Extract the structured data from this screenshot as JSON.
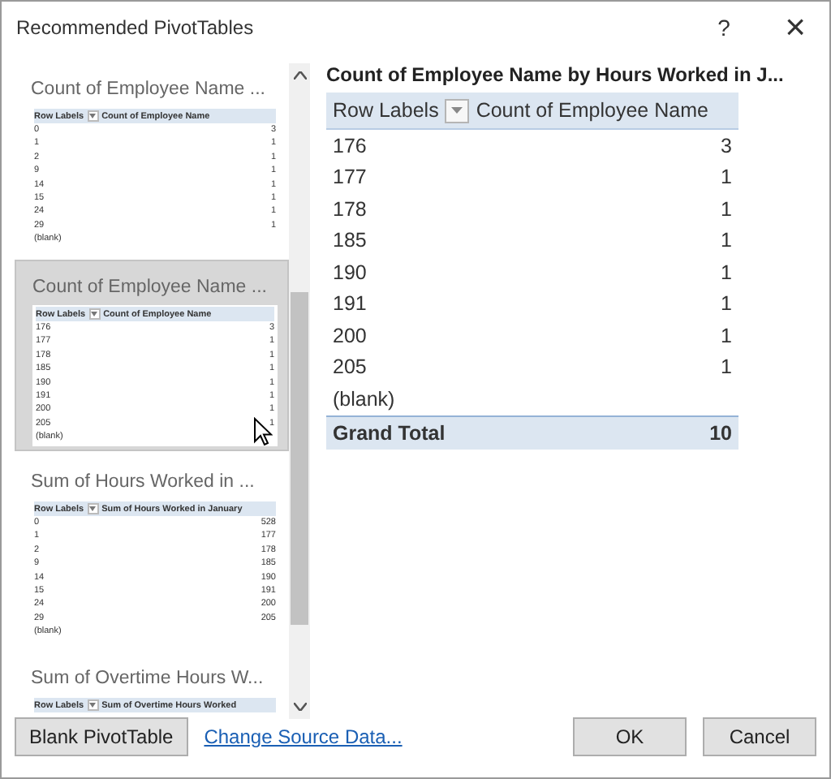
{
  "window": {
    "title": "Recommended PivotTables",
    "help": "?",
    "close": "×"
  },
  "thumbnails": [
    {
      "title": "Count of Employee Name ...",
      "selected": false,
      "headers": [
        "Row Labels",
        "Count of Employee Name"
      ],
      "rows": [
        [
          "0",
          "3"
        ],
        [
          "1",
          "1"
        ],
        [
          "2",
          "1"
        ],
        [
          "9",
          "1"
        ],
        [
          "14",
          "1"
        ],
        [
          "15",
          "1"
        ],
        [
          "24",
          "1"
        ],
        [
          "29",
          "1"
        ],
        [
          "(blank)",
          ""
        ]
      ]
    },
    {
      "title": "Count of Employee Name ...",
      "selected": true,
      "headers": [
        "Row Labels",
        "Count of Employee Name"
      ],
      "rows": [
        [
          "176",
          "3"
        ],
        [
          "177",
          "1"
        ],
        [
          "178",
          "1"
        ],
        [
          "185",
          "1"
        ],
        [
          "190",
          "1"
        ],
        [
          "191",
          "1"
        ],
        [
          "200",
          "1"
        ],
        [
          "205",
          "1"
        ],
        [
          "(blank)",
          ""
        ]
      ]
    },
    {
      "title": "Sum of Hours Worked in ...",
      "selected": false,
      "headers": [
        "Row Labels",
        "Sum of Hours Worked in January"
      ],
      "rows": [
        [
          "0",
          "528"
        ],
        [
          "1",
          "177"
        ],
        [
          "2",
          "178"
        ],
        [
          "9",
          "185"
        ],
        [
          "14",
          "190"
        ],
        [
          "15",
          "191"
        ],
        [
          "24",
          "200"
        ],
        [
          "29",
          "205"
        ],
        [
          "(blank)",
          ""
        ]
      ]
    },
    {
      "title": "Sum of Overtime Hours W...",
      "selected": false,
      "headers": [
        "Row Labels",
        "Sum of Overtime Hours Worked"
      ]
    }
  ],
  "preview": {
    "title": "Count of Employee Name by Hours Worked in J...",
    "headers": [
      "Row Labels",
      "Count of Employee Name"
    ],
    "rows": [
      [
        "176",
        "3"
      ],
      [
        "177",
        "1"
      ],
      [
        "178",
        "1"
      ],
      [
        "185",
        "1"
      ],
      [
        "190",
        "1"
      ],
      [
        "191",
        "1"
      ],
      [
        "200",
        "1"
      ],
      [
        "205",
        "1"
      ],
      [
        "(blank)",
        ""
      ]
    ],
    "total": [
      "Grand Total",
      "10"
    ]
  },
  "buttons": {
    "blank": "Blank PivotTable",
    "link": "Change Source Data...",
    "ok": "OK",
    "cancel": "Cancel"
  }
}
